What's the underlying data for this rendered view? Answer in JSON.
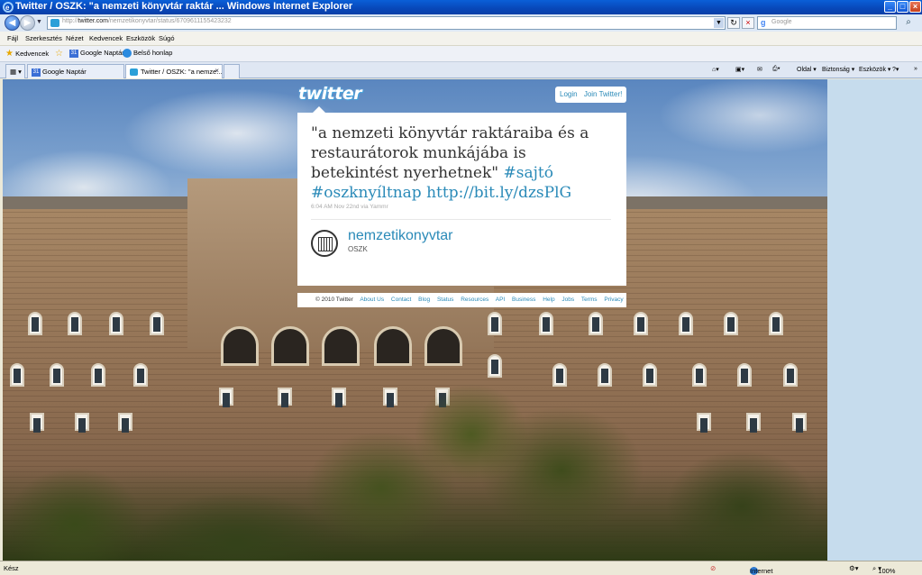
{
  "window": {
    "title": "Twitter / OSZK: \"a nemzeti könyvtár raktár ... Windows Internet Explorer"
  },
  "address": {
    "url_prefix": "http://",
    "url_host": "twitter.com",
    "url_path": "/nemzetikonyvtar/status/6709611155423232",
    "search_placeholder": "Google"
  },
  "menu": [
    "Fájl",
    "Szerkesztés",
    "Nézet",
    "Kedvencek",
    "Eszközök",
    "Súgó"
  ],
  "favorites": {
    "label": "Kedvencek",
    "items": [
      "Google Naptár",
      "Belső honlap"
    ]
  },
  "tabs": [
    {
      "label": "Google Naptár",
      "active": false
    },
    {
      "label": "Twitter / OSZK: \"a nemze...",
      "active": true
    }
  ],
  "commandbar": {
    "page": "Oldal",
    "safety": "Biztonság",
    "tools": "Eszközök"
  },
  "twitter": {
    "logo": "twitter",
    "login": "Login",
    "join": "Join Twitter!",
    "tweet_text": "\"a nemzeti könyvtár raktáraiba és a restaurátorok munkájába is betekintést nyerhetnek\"",
    "hashtag1": "#sajtó",
    "hashtag2": "#oszknyíltnap",
    "link": "http://bit.ly/dzsPlG",
    "meta": "6:04 AM Nov 22nd via Yammr",
    "username": "nemzetikonyvtar",
    "fullname": "OSZK",
    "footer": {
      "copyright": "© 2010 Twitter",
      "links": [
        "About Us",
        "Contact",
        "Blog",
        "Status",
        "Resources",
        "API",
        "Business",
        "Help",
        "Jobs",
        "Terms",
        "Privacy"
      ]
    }
  },
  "status": {
    "left": "Kész",
    "zone": "Internet",
    "zoom": "100%"
  },
  "colors": {
    "twitter_link": "#2a8ab8",
    "titlebar": "#0847b8"
  }
}
